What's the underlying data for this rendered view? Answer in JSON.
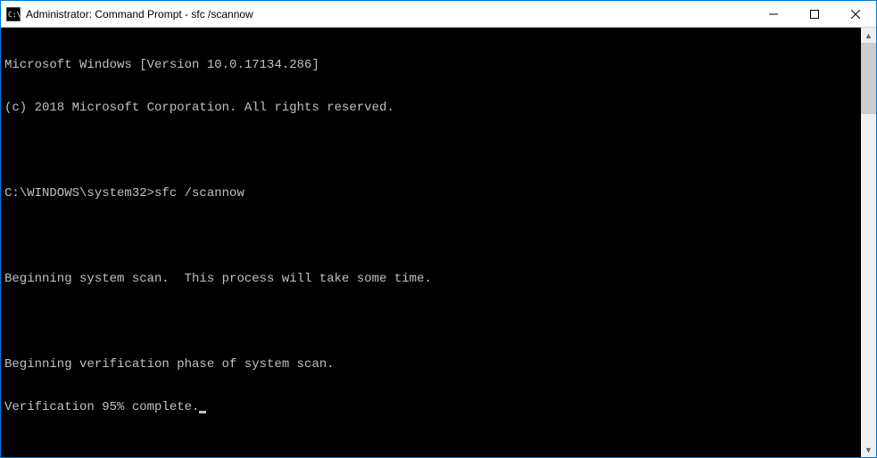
{
  "window": {
    "title": "Administrator: Command Prompt - sfc  /scannow"
  },
  "terminal": {
    "lines": [
      "Microsoft Windows [Version 10.0.17134.286]",
      "(c) 2018 Microsoft Corporation. All rights reserved.",
      "",
      "C:\\WINDOWS\\system32>sfc /scannow",
      "",
      "Beginning system scan.  This process will take some time.",
      "",
      "Beginning verification phase of system scan.",
      "Verification 95% complete."
    ],
    "progress_percent": 95
  }
}
